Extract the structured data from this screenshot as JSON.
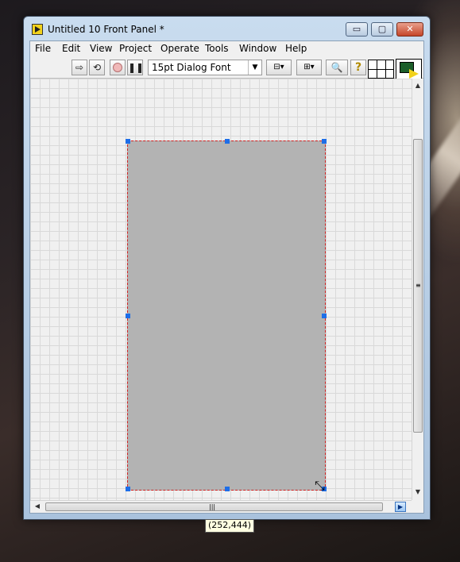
{
  "window": {
    "title": "Untitled 10 Front Panel *",
    "caption_buttons": {
      "minimize": "▭",
      "maximize": "▢",
      "close": "✕"
    }
  },
  "menu": [
    "File",
    "Edit",
    "View",
    "Project",
    "Operate",
    "Tools",
    "Window",
    "Help"
  ],
  "toolbar": {
    "run_icon": "run-arrow-icon",
    "run_continuous_icon": "run-continuously-icon",
    "abort_icon": "abort-icon",
    "pause_icon": "pause-icon",
    "font_value": "15pt Dialog Font",
    "align_icon": "align-objects-icon",
    "distribute_icon": "distribute-objects-icon",
    "search_icon": "search-icon",
    "help_icon": "help-icon",
    "connector_icon": "connector-pane-icon",
    "vi_icon": "vi-icon"
  },
  "canvas": {
    "selected_object": "decoration-rectangle",
    "selection_color": "#b3b3b3",
    "selection_border": "#d02020",
    "handle_color": "#1e6ee8"
  },
  "tooltip": {
    "coordinates": "(252,444)"
  }
}
